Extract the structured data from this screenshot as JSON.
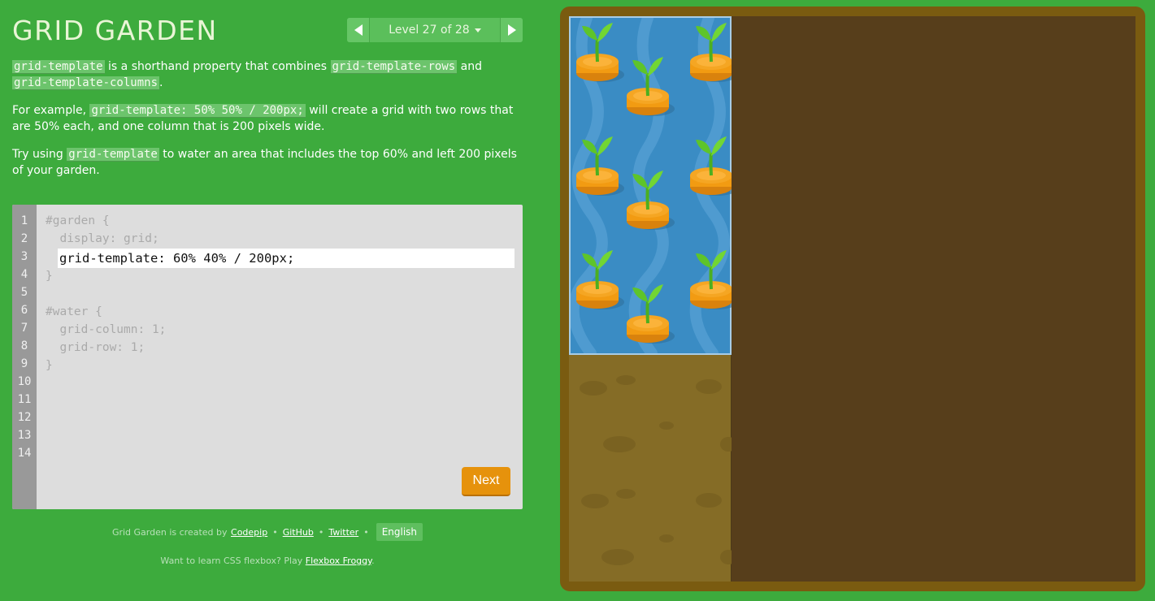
{
  "app": {
    "title": "GRID GARDEN"
  },
  "level_nav": {
    "label": "Level 27 of 28",
    "prev_icon": "triangle-left-icon",
    "next_icon": "triangle-right-icon",
    "dropdown_icon": "caret-down-icon"
  },
  "instructions": {
    "p1": {
      "code1": "grid-template",
      "text1": " is a shorthand property that combines ",
      "code2": "grid-template-rows",
      "text2": " and ",
      "code3": "grid-template-columns",
      "text3": "."
    },
    "p2": {
      "text1": "For example, ",
      "code1": "grid-template: 50% 50% / 200px;",
      "text2": " will create a grid with two rows that are 50% each, and one column that is 200 pixels wide."
    },
    "p3": {
      "text1": "Try using ",
      "code1": "grid-template",
      "text2": " to water an area that includes the top 60% and left 200 pixels of your garden."
    }
  },
  "editor": {
    "line_numbers": [
      "1",
      "2",
      "3",
      "4",
      "5",
      "6",
      "7",
      "8",
      "9",
      "10",
      "11",
      "12",
      "13",
      "14"
    ],
    "lines": {
      "l1": "#garden {",
      "l2": "  display: grid;",
      "l4": "}",
      "l6": "#water {",
      "l7": "  grid-column: 1;",
      "l8": "  grid-row: 1;",
      "l9": "}"
    },
    "input_value": "grid-template: 60% 40% / 200px;",
    "next_label": "Next"
  },
  "footer": {
    "created_by": "Grid Garden is created by",
    "codepip": "Codepip",
    "github": "GitHub",
    "twitter": "Twitter",
    "language": "English",
    "froggy_prefix": "Want to learn CSS flexbox? Play ",
    "froggy_link": "Flexbox Froggy",
    "froggy_suffix": "."
  },
  "garden": {
    "water_area": "top 60%, left 200px",
    "plant_icon": "carrot-sprout-icon"
  },
  "colors": {
    "background": "#3dab3d",
    "code_highlight": "#6cc46c",
    "editor_bg": "#dddddd",
    "gutter": "#999999",
    "next_button": "#e6920c",
    "garden_frame": "#7a5b10",
    "soil_dark": "#573e1b",
    "soil_light": "#856c26",
    "water": "#3a8cc4"
  }
}
